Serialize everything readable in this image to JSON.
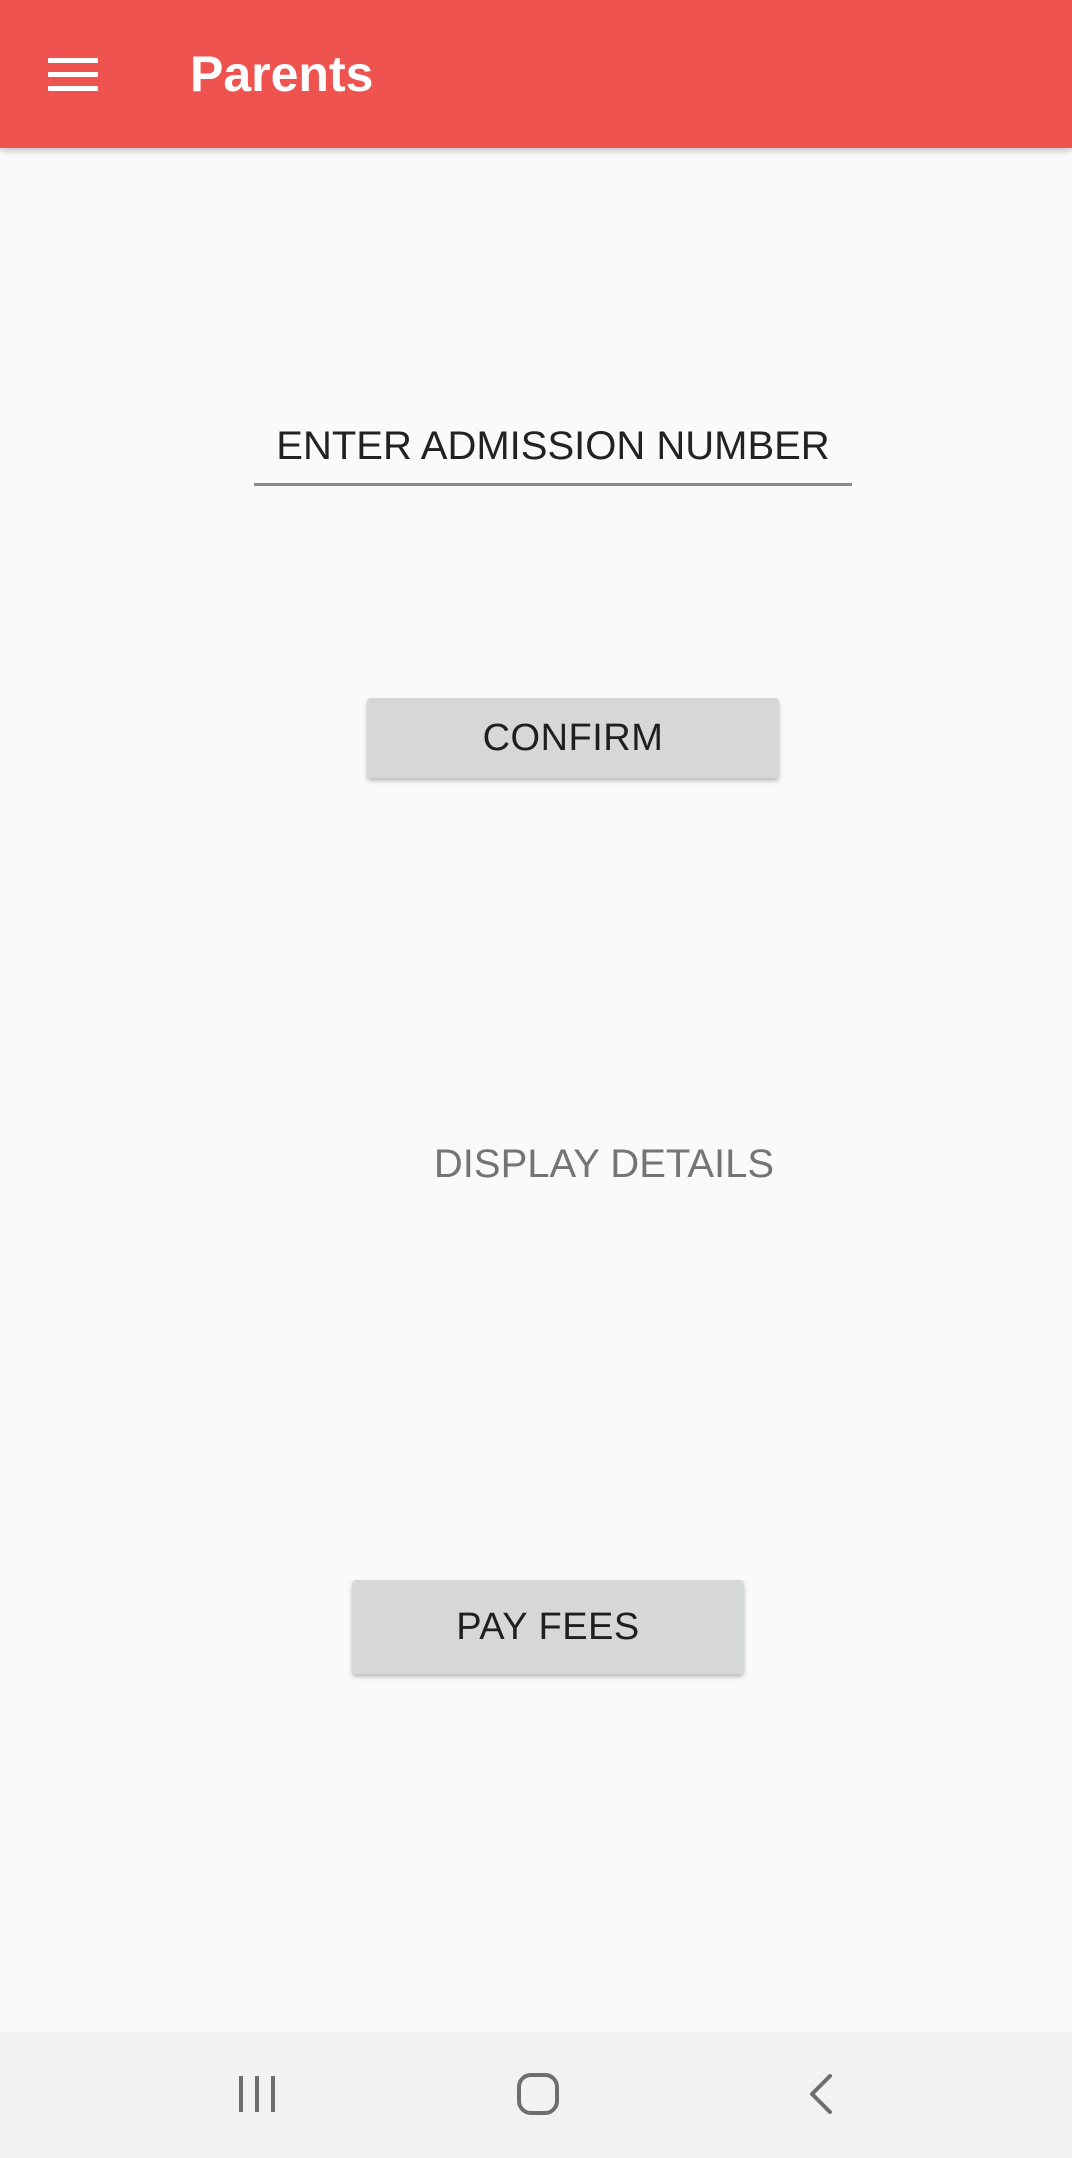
{
  "app_bar": {
    "title": "Parents",
    "menu_icon": "hamburger-menu-icon",
    "background_color": "#ef5350"
  },
  "form": {
    "admission_field": {
      "placeholder": "ENTER ADMISSION NUMBER",
      "value": ""
    },
    "confirm_button_label": "CONFIRM",
    "details_text": "DISPLAY DETAILS",
    "pay_fees_button_label": "PAY FEES"
  },
  "system_nav": {
    "recents_icon": "recent-apps-icon",
    "home_icon": "home-icon",
    "back_icon": "back-icon"
  }
}
